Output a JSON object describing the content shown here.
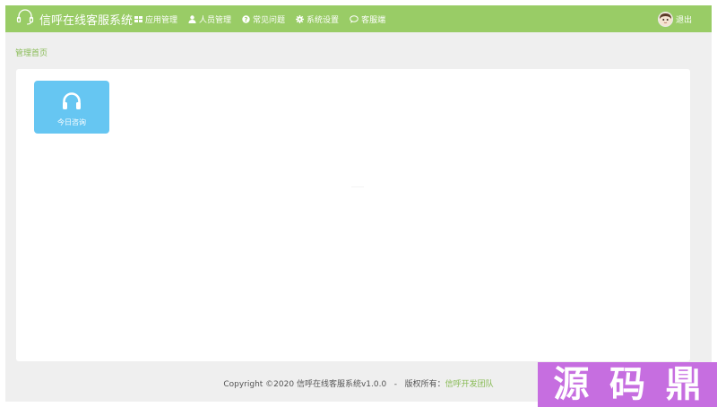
{
  "app": {
    "title": "信呼在线客服系统",
    "brand_icon": "headset-icon"
  },
  "colors": {
    "navbar": "#99cc66",
    "page_bg": "#efefef",
    "tile": "#66c6f2",
    "link": "#88bb55",
    "watermark": "#c66ee0"
  },
  "nav": {
    "items": [
      {
        "label": "应用管理",
        "icon": "grid-icon"
      },
      {
        "label": "人员管理",
        "icon": "user-icon"
      },
      {
        "label": "常见问题",
        "icon": "question-circle-icon"
      },
      {
        "label": "系统设置",
        "icon": "gear-icon"
      },
      {
        "label": "客服端",
        "icon": "chat-bubble-icon"
      }
    ]
  },
  "user": {
    "avatar": "avatar",
    "logout_label": "退出"
  },
  "breadcrumb": {
    "current": "管理首页"
  },
  "tiles": [
    {
      "label": "今日咨询",
      "icon": "headphones-icon"
    }
  ],
  "footer": {
    "copyright": "Copyright ©2020 信呼在线客服系统v1.0.0",
    "separator": "-",
    "rights_label": "版权所有：",
    "team": "信呼开发团队"
  },
  "watermark": {
    "chars": [
      "源",
      "码",
      "鼎"
    ]
  }
}
